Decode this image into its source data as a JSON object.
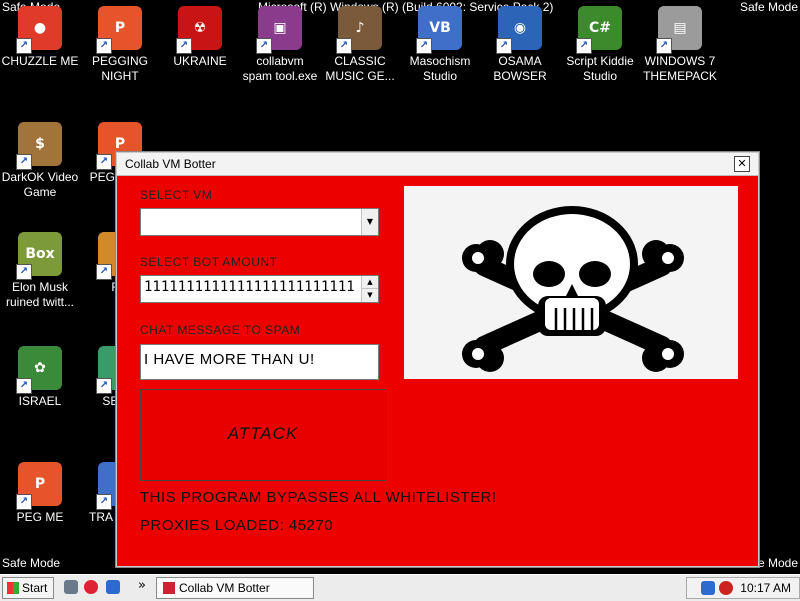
{
  "corners": {
    "top_left": "Safe Mode",
    "top_right": "Safe Mode",
    "bottom_left": "Safe Mode",
    "bottom_right": "Safe Mode"
  },
  "build_text": "Microsoft (R) Windows (R) (Build 6002: Service Pack 2)",
  "icons": [
    {
      "label": "CHUZZLE ME",
      "color": "#e03a2a",
      "glyph": "●"
    },
    {
      "label": "PEGGING NIGHT",
      "color": "#e5542b",
      "glyph": "P"
    },
    {
      "label": "UKRAINE",
      "color": "#c81414",
      "glyph": "☢"
    },
    {
      "label": "collabvm spam tool.exe",
      "color": "#8a3b8b",
      "glyph": "▣"
    },
    {
      "label": "CLASSIC MUSIC GE...",
      "color": "#7a5a3a",
      "glyph": "♪"
    },
    {
      "label": "Masochism Studio",
      "color": "#3f6fc9",
      "glyph": "VB"
    },
    {
      "label": "OSAMA BOWSER",
      "color": "#2c64b8",
      "glyph": "◉"
    },
    {
      "label": "Script Kiddie Studio",
      "color": "#3c8a2c",
      "glyph": "C#"
    },
    {
      "label": "WINDOWS 7 THEMEPACK",
      "color": "#9b9b9b",
      "glyph": "▤"
    },
    {
      "label": "DarkOK Video Game",
      "color": "#a0743a",
      "glyph": "$"
    },
    {
      "label": "PEG WOW",
      "color": "#e5542b",
      "glyph": "P"
    },
    {
      "label": "Elon Musk ruined twitt...",
      "color": "#7c9a3a",
      "glyph": "Box"
    },
    {
      "label": "RU",
      "color": "#d08a2a",
      "glyph": "R"
    },
    {
      "label": "ISRAEL",
      "color": "#3a8a3a",
      "glyph": "✿"
    },
    {
      "label": "SEX E",
      "color": "#3a9a6a",
      "glyph": "H"
    },
    {
      "label": "PEG ME",
      "color": "#e5542b",
      "glyph": "P"
    },
    {
      "label": "TRA CONN",
      "color": "#3f6fc9",
      "glyph": "T"
    }
  ],
  "window": {
    "title": "Collab VM Botter",
    "close": "✕",
    "select_vm_label": "SELECT VM",
    "select_vm_value": "",
    "bot_amount_label": "SELECT BOT AMOUNT",
    "bot_amount_value": "1111111111111111111111111",
    "chat_label": "CHAT MESSAGE TO SPAM",
    "chat_value": "I HAVE MORE THAN U!",
    "attack_label": "ATTACK",
    "bypass_text": "THIS PROGRAM BYPASSES ALL WHITELISTER!",
    "proxies_text": "PROXIES LOADED: 45270"
  },
  "taskbar": {
    "start_label": "Start",
    "task_label": "Collab VM Botter",
    "chevron": "»",
    "clock": "10:17 AM"
  }
}
